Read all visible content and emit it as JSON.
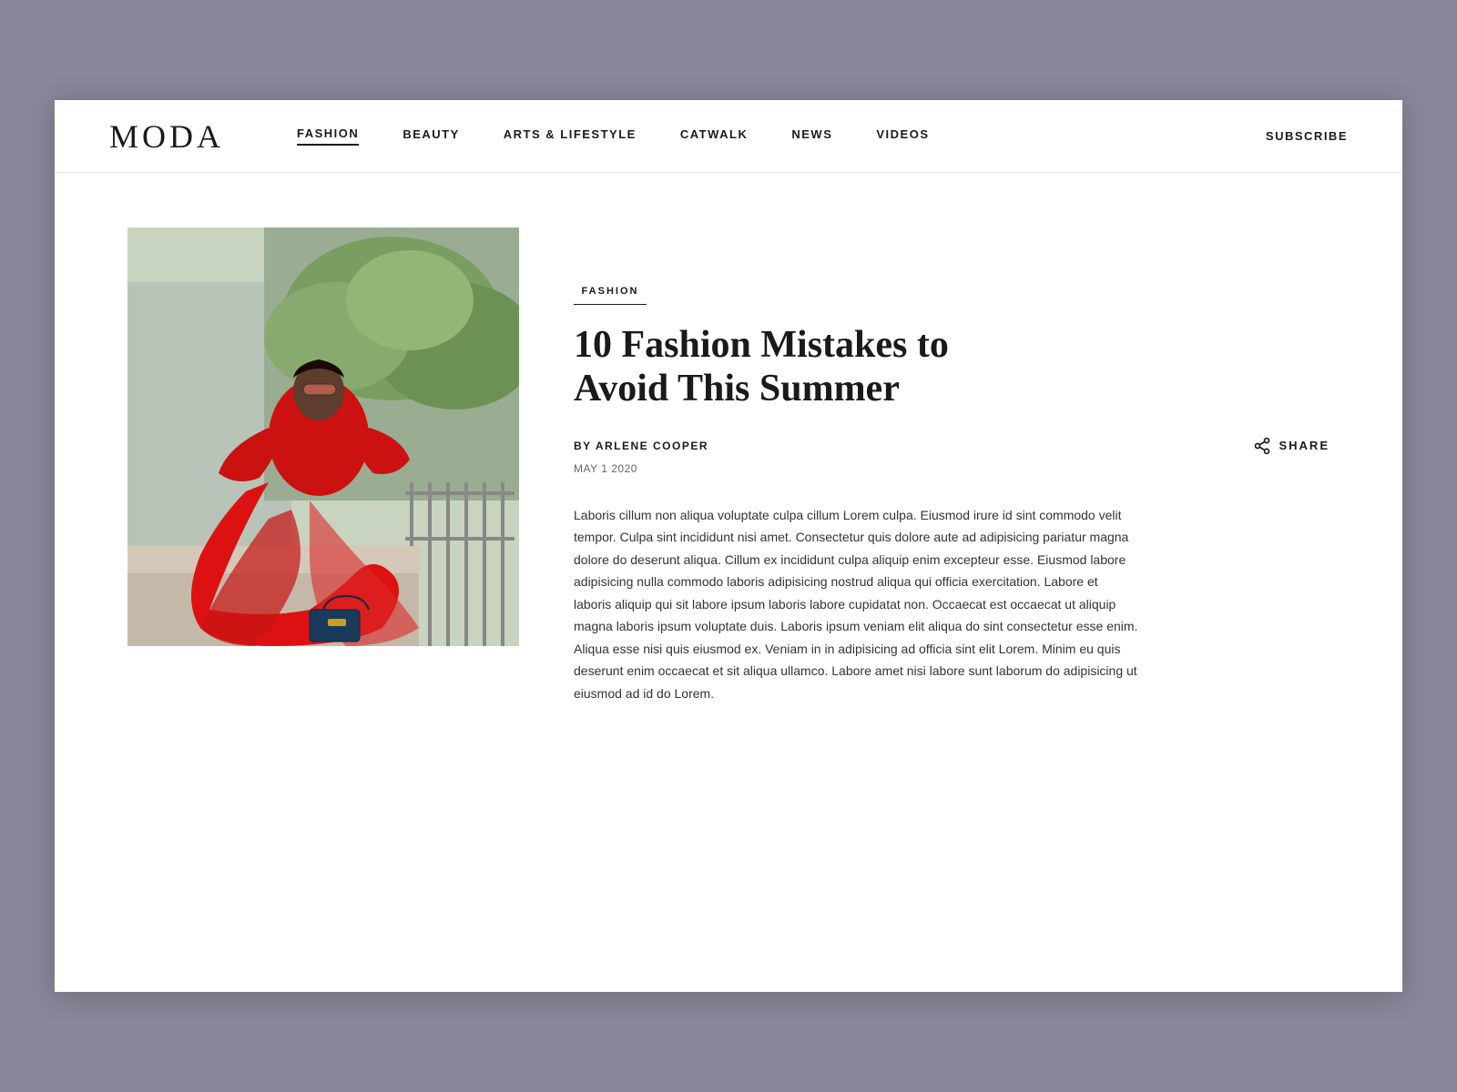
{
  "site": {
    "logo": "MODA"
  },
  "nav": {
    "links": [
      {
        "label": "FASHION",
        "active": true
      },
      {
        "label": "BEAUTY",
        "active": false
      },
      {
        "label": "ARTS & LIFESTYLE",
        "active": false
      },
      {
        "label": "CATWALK",
        "active": false
      },
      {
        "label": "NEWS",
        "active": false
      },
      {
        "label": "VIDEOS",
        "active": false
      }
    ],
    "subscribe_label": "SUBSCRIBE"
  },
  "article": {
    "category": "FASHION",
    "title": "10 Fashion Mistakes to Avoid This Summer",
    "author_prefix": "BY ARLENE COOPER",
    "date": "MAY 1 2020",
    "share_label": "SHARE",
    "body": "Laboris cillum non aliqua voluptate culpa cillum Lorem culpa. Eiusmod irure id sint commodo velit tempor. Culpa sint incididunt nisi amet. Consectetur quis dolore aute ad adipisicing pariatur magna dolore do deserunt aliqua. Cillum ex incididunt culpa aliquip enim excepteur esse. Eiusmod labore adipisicing nulla commodo laboris adipisicing nostrud aliqua qui officia exercitation. Labore et laboris aliquip qui sit labore ipsum laboris labore cupidatat non. Occaecat est occaecat ut aliquip magna laboris ipsum voluptate duis. Laboris ipsum veniam elit aliqua do sint consectetur esse enim. Aliqua esse nisi quis eiusmod ex. Veniam in in adipisicing ad officia sint elit Lorem. Minim eu quis deserunt enim occaecat et sit aliqua ullamco. Labore amet nisi labore sunt laborum do adipisicing ut eiusmod ad id do Lorem."
  },
  "colors": {
    "background": "#8a8599",
    "white": "#ffffff",
    "dark": "#1a1a1a",
    "gray": "#666666"
  }
}
